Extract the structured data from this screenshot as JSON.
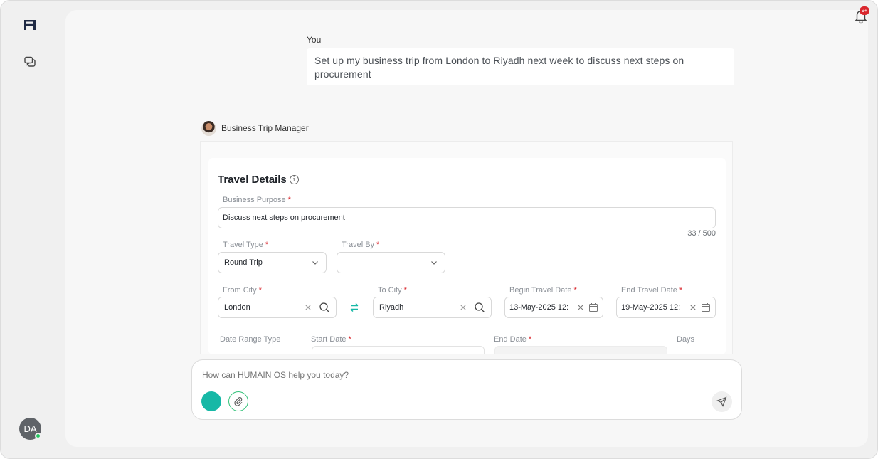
{
  "sidebar": {
    "logo_icon": "humain-logo-icon",
    "chat_icon": "chat-bubbles-icon",
    "user_initials": "DA"
  },
  "header": {
    "notification_icon": "bell-icon",
    "notification_badge": "9+"
  },
  "conversation": {
    "user_label": "You",
    "user_message": "Set up my business trip from London to Riyadh next week to discuss next steps on procurement",
    "agent_name": "Business Trip Manager"
  },
  "travel_form": {
    "title": "Travel Details",
    "info_icon": "i",
    "business_purpose": {
      "label": "Business Purpose",
      "value": "Discuss next steps on procurement",
      "counter": "33 / 500"
    },
    "travel_type": {
      "label": "Travel Type",
      "value": "Round Trip"
    },
    "travel_by": {
      "label": "Travel By",
      "value": ""
    },
    "from_city": {
      "label": "From City",
      "value": "London"
    },
    "to_city": {
      "label": "To City",
      "value": "Riyadh"
    },
    "begin_travel_date": {
      "label": "Begin Travel Date",
      "value": "13-May-2025 12:"
    },
    "end_travel_date": {
      "label": "End Travel Date",
      "value": "19-May-2025 12:"
    },
    "date_range_type": {
      "label": "Date Range Type"
    },
    "start_date": {
      "label": "Start Date"
    },
    "end_date": {
      "label": "End Date"
    },
    "days": {
      "label": "Days"
    },
    "required_mark": "*"
  },
  "composer": {
    "placeholder": "How can HUMAIN OS help you today?"
  },
  "colors": {
    "accent_teal": "#17b8a6",
    "required_red": "#d9262c",
    "online_green": "#22c55e"
  }
}
